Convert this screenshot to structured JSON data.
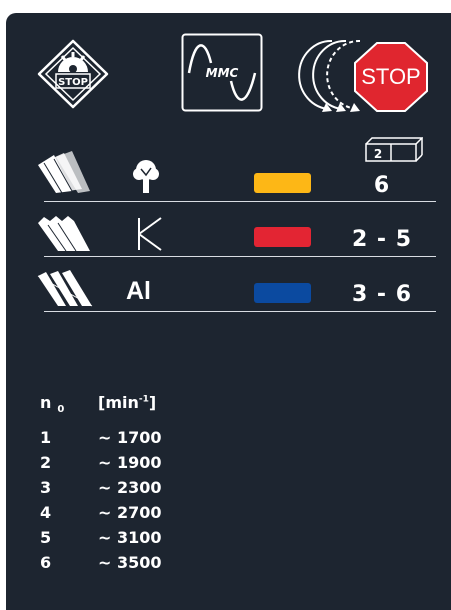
{
  "header": {
    "stop_badge_text": "STOP",
    "mmc_label": "MMC",
    "stop_sign_text": "STOP"
  },
  "colors": {
    "panel_bg": "#1d2530",
    "yellow_swatch": "#fdb716",
    "red_swatch": "#e32533",
    "blue_swatch": "#0b4aa0",
    "stop_sign": "#e0262f"
  },
  "speed_selector": {
    "value": "2"
  },
  "material_rows": [
    {
      "icon": "tree-icon",
      "material_label": "",
      "color": "yellow",
      "setting": "6"
    },
    {
      "icon": "plastic-k-icon",
      "material_label": "",
      "color": "red",
      "setting": "2 - 5"
    },
    {
      "icon": "aluminium-icon",
      "material_label": "Al",
      "color": "blue",
      "setting": "3 - 6"
    }
  ],
  "rpm_table": {
    "col_n_label": "n",
    "col_n_sub": "0",
    "col_unit_label": "[min",
    "col_unit_sup": "-1",
    "col_unit_close": "]",
    "rows": [
      {
        "n": "1",
        "rpm": "~ 1700"
      },
      {
        "n": "2",
        "rpm": "~ 1900"
      },
      {
        "n": "3",
        "rpm": "~ 2300"
      },
      {
        "n": "4",
        "rpm": "~ 2700"
      },
      {
        "n": "5",
        "rpm": "~ 3100"
      },
      {
        "n": "6",
        "rpm": "~ 3500"
      }
    ]
  }
}
